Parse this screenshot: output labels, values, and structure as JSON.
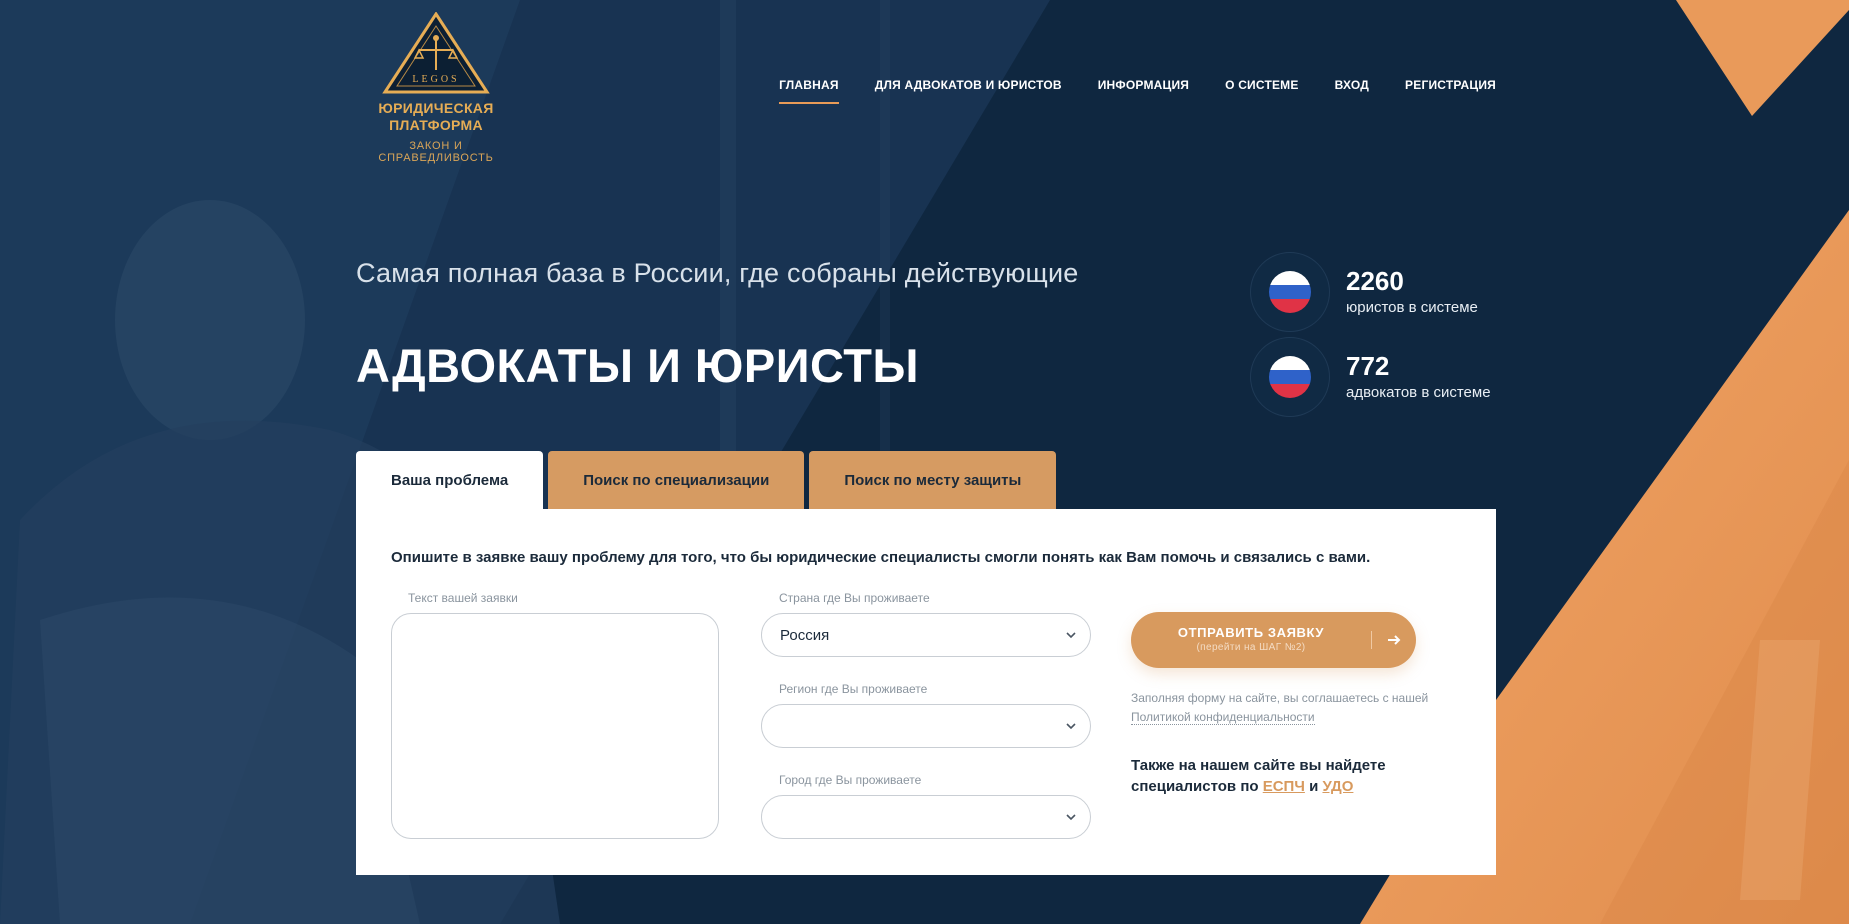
{
  "logo": {
    "title": "ЮРИДИЧЕСКАЯ ПЛАТФОРМА",
    "subtitle": "ЗАКОН И СПРАВЕДЛИВОСТЬ",
    "emblem_text": "LEGOS",
    "icon": "scales-triangle-icon"
  },
  "nav": {
    "items": [
      {
        "label": "ГЛАВНАЯ"
      },
      {
        "label": "ДЛЯ АДВОКАТОВ И ЮРИСТОВ"
      },
      {
        "label": "ИНФОРМАЦИЯ"
      },
      {
        "label": "О СИСТЕМЕ"
      },
      {
        "label": "ВХОД"
      },
      {
        "label": "РЕГИСТРАЦИЯ"
      }
    ]
  },
  "hero": {
    "subtitle": "Самая полная база в России, где собраны действующие",
    "title": "АДВОКАТЫ И ЮРИСТЫ"
  },
  "stats": [
    {
      "value": "2260",
      "label": "юристов в системе",
      "icon": "russia-flag-icon"
    },
    {
      "value": "772",
      "label": "адвокатов в системе",
      "icon": "russia-flag-icon"
    }
  ],
  "tabs": [
    {
      "label": "Ваша проблема"
    },
    {
      "label": "Поиск по специализации"
    },
    {
      "label": "Поиск по месту защиты"
    }
  ],
  "form": {
    "intro": "Опишите в заявке вашу проблему для того, что бы юридические специалисты смогли понять как Вам помочь и связались с вами.",
    "request_label": "Текст вашей заявки",
    "country_label": "Страна где Вы проживаете",
    "country_value": "Россия",
    "region_label": "Регион где Вы проживаете",
    "region_value": "",
    "city_label": "Город где Вы проживаете",
    "city_value": "",
    "submit_label": "ОТПРАВИТЬ ЗАЯВКУ",
    "submit_hint": "(перейти на ШАГ №2)",
    "consent_text": "Заполняя форму на сайте, вы соглашаетесь с нашей",
    "consent_link": "Политикой конфиденциальности",
    "also_text_1": "Также на нашем сайте вы найдете специалистов по",
    "also_link_1": "ЕСПЧ",
    "also_and": "и",
    "also_link_2": "УДО"
  },
  "colors": {
    "navy": "#0f2740",
    "accent": "#d89a5e",
    "orange_bg": "#e99a5a",
    "logo_gold": "#e6ad55"
  }
}
